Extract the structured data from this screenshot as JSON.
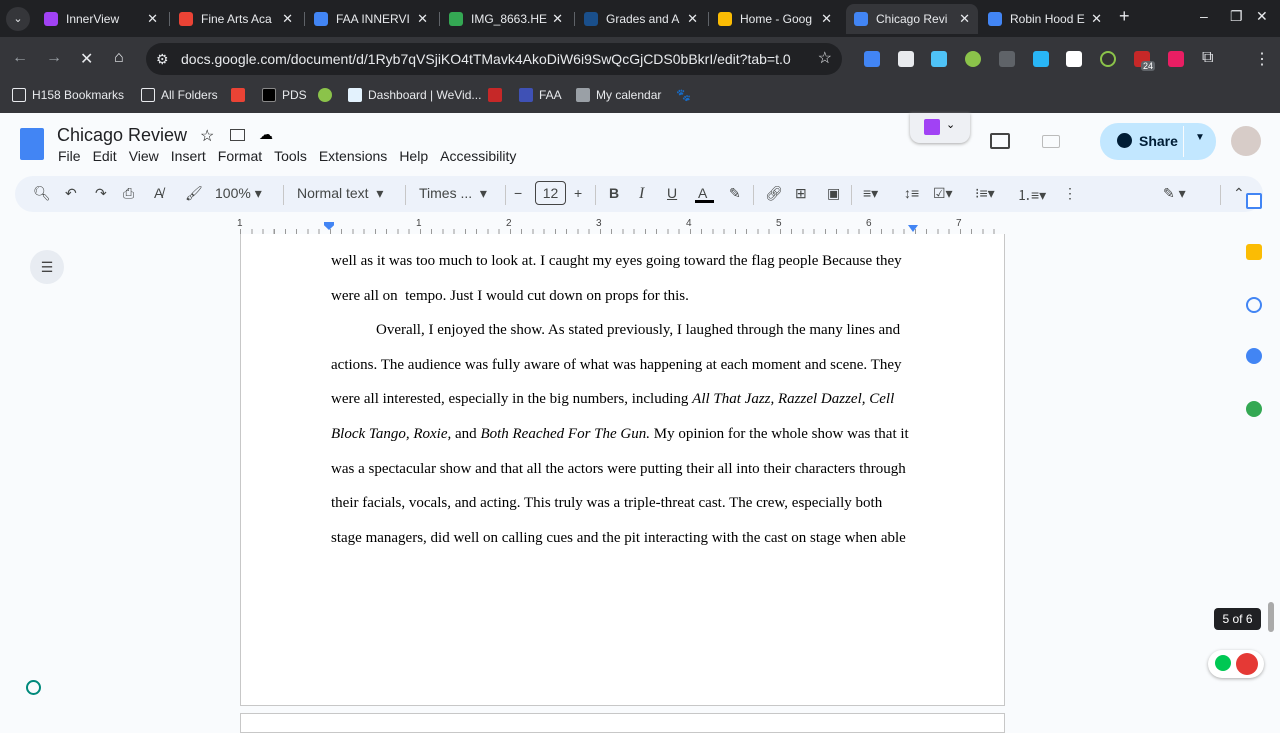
{
  "browser": {
    "tabs": [
      {
        "title": "InnerView",
        "color": "#a142f4"
      },
      {
        "title": "Fine Arts Aca",
        "color": "#ea4335"
      },
      {
        "title": "FAA INNERVI",
        "color": "#4285f4"
      },
      {
        "title": "IMG_8663.HE",
        "color": "#34a853"
      },
      {
        "title": "Grades and A",
        "color": "#1a4f8b"
      },
      {
        "title": "Home - Goog",
        "color": "#fbbc04"
      },
      {
        "title": "Chicago Revi",
        "color": "#4285f4"
      },
      {
        "title": "Robin Hood E",
        "color": "#4285f4"
      }
    ],
    "url": "docs.google.com/document/d/1Ryb7qVSjiKO4tTMavk4AkoDiW6i9SwQcGjCDS0bBkrI/edit?tab=t.0",
    "extension_badge": "24",
    "bookmarks": [
      "H158 Bookmarks",
      "All Folders",
      "PDS",
      "Dashboard | WeVid...",
      "FAA",
      "My calendar"
    ]
  },
  "doc": {
    "title": "Chicago Review",
    "menu": [
      "File",
      "Edit",
      "View",
      "Insert",
      "Format",
      "Tools",
      "Extensions",
      "Help",
      "Accessibility"
    ],
    "share_label": "Share",
    "toolbar": {
      "zoom": "100%",
      "style": "Normal text",
      "font": "Times ...",
      "font_size": "12",
      "text_color": "#000000"
    },
    "ruler": [
      "1",
      "1",
      "2",
      "3",
      "4",
      "5",
      "6",
      "7"
    ],
    "lines": [
      [
        {
          "t": "well as it was too much to look at. I caught my eyes going toward the flag people Because they"
        }
      ],
      [
        {
          "t": "were all on  tempo. Just I would cut down on props for this."
        }
      ],
      [
        {
          "t": "Overall, I enjoyed the show. As stated previously, I laughed through the many lines and"
        }
      ],
      [
        {
          "t": "actions. The audience was fully aware of what was happening at each moment and scene. They"
        }
      ],
      [
        {
          "t": "were all interested, especially in the big numbers, including "
        },
        {
          "t": "All That Jazz, Razzel Dazzel, Cell",
          "i": true
        }
      ],
      [
        {
          "t": "Block Tango, Roxie,",
          "i": true
        },
        {
          "t": " and "
        },
        {
          "t": "Both Reached For The Gun.",
          "i": true
        },
        {
          "t": " My opinion for the whole show was that it"
        }
      ],
      [
        {
          "t": "was a spectacular show and that all the actors were putting their all into their characters through"
        }
      ],
      [
        {
          "t": "their facials, vocals, and acting. This truly was a triple-threat cast. The crew, especially both"
        }
      ],
      [
        {
          "t": "stage managers, did well on calling cues and the pit interacting with the cast on stage when able"
        }
      ]
    ],
    "page_indicator": "5 of 6"
  }
}
